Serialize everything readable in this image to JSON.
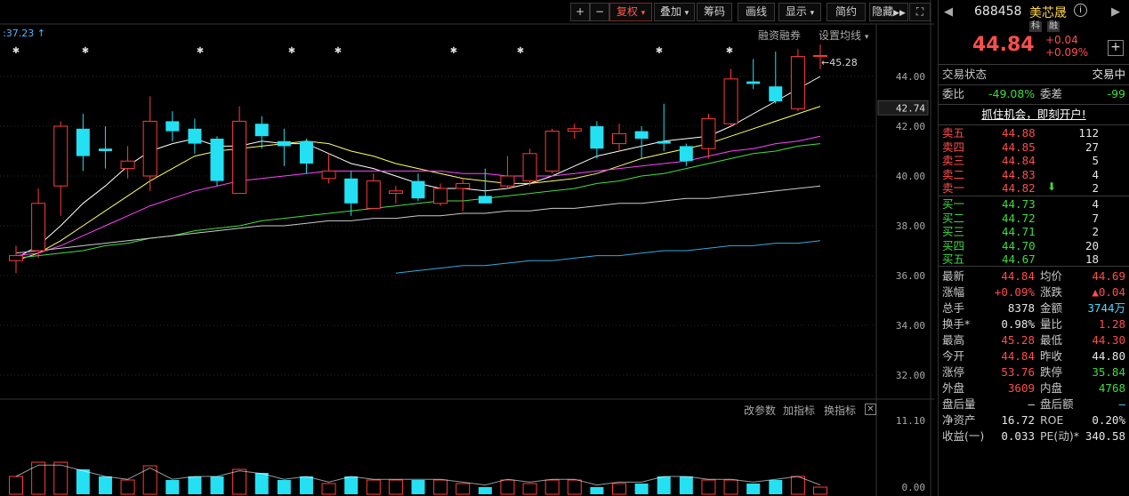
{
  "toolbar": {
    "plus": "+",
    "minus": "−",
    "fuquan": "复权",
    "overlay": "叠加",
    "chips": "筹码",
    "draw": "画线",
    "display": "显示",
    "simple": "简约",
    "hide": "隐藏"
  },
  "main": {
    "top_label": ":37.23",
    "margin_trading": "融资融券",
    "ma_settings": "设置均线",
    "max_marker": "45.28",
    "y_ticks": [
      "44.00",
      "42.00",
      "40.00",
      "38.00",
      "36.00",
      "34.00",
      "32.00"
    ],
    "current_price_tag": "42.74",
    "sub_links": [
      "改参数",
      "加指标",
      "换指标"
    ],
    "sub_axis": [
      "11.10",
      "0.00"
    ],
    "colors": {
      "up": "#ff3b3b",
      "down": "#23e0f2",
      "bg": "#000000"
    }
  },
  "chart_data": {
    "type": "candlestick",
    "ylim": [
      31,
      46
    ],
    "candles": [
      [
        36.6,
        36.8,
        37.2,
        36.1
      ],
      [
        37.0,
        38.9,
        39.5,
        36.7
      ],
      [
        39.6,
        42.0,
        42.2,
        38.4
      ],
      [
        41.9,
        40.8,
        42.5,
        40.2
      ],
      [
        41.1,
        41.0,
        42.0,
        40.3
      ],
      [
        40.3,
        40.6,
        41.2,
        39.9
      ],
      [
        40.0,
        42.2,
        43.2,
        39.4
      ],
      [
        42.2,
        41.8,
        42.6,
        41.4
      ],
      [
        41.9,
        41.3,
        42.3,
        40.9
      ],
      [
        41.5,
        39.8,
        41.6,
        39.6
      ],
      [
        39.3,
        42.2,
        42.8,
        39.3
      ],
      [
        42.1,
        41.6,
        42.4,
        41.1
      ],
      [
        41.4,
        41.2,
        41.9,
        40.4
      ],
      [
        41.4,
        40.5,
        41.5,
        40.1
      ],
      [
        39.9,
        40.2,
        40.9,
        39.7
      ],
      [
        39.9,
        38.9,
        40.2,
        38.4
      ],
      [
        38.7,
        39.8,
        40.1,
        38.7
      ],
      [
        39.3,
        39.4,
        39.6,
        38.9
      ],
      [
        39.8,
        39.1,
        40.1,
        39.0
      ],
      [
        38.9,
        39.5,
        39.7,
        38.8
      ],
      [
        39.5,
        39.7,
        39.9,
        38.6
      ],
      [
        39.2,
        38.9,
        40.3,
        38.9
      ],
      [
        39.6,
        40.0,
        40.8,
        39.5
      ],
      [
        39.8,
        40.9,
        41.1,
        39.6
      ],
      [
        40.2,
        41.8,
        41.9,
        40.1
      ],
      [
        41.8,
        41.9,
        42.1,
        41.5
      ],
      [
        42.0,
        41.1,
        42.2,
        40.7
      ],
      [
        41.3,
        41.7,
        42.1,
        41.0
      ],
      [
        41.8,
        41.5,
        42.0,
        40.7
      ],
      [
        41.4,
        41.3,
        42.9,
        41.0
      ],
      [
        41.2,
        40.6,
        41.3,
        40.4
      ],
      [
        41.1,
        42.3,
        42.5,
        40.7
      ],
      [
        42.1,
        43.9,
        44.3,
        42.0
      ],
      [
        43.8,
        43.7,
        44.7,
        43.5
      ],
      [
        43.6,
        43.0,
        45.0,
        42.9
      ],
      [
        42.7,
        44.8,
        45.1,
        42.6
      ],
      [
        44.8,
        44.84,
        45.28,
        44.3
      ]
    ],
    "ma_lines": [
      {
        "color": "#ffffff",
        "values": [
          36.7,
          37.2,
          38.0,
          38.9,
          39.6,
          40.4,
          41.0,
          41.3,
          41.5,
          41.2,
          41.2,
          41.4,
          41.3,
          41.3,
          40.9,
          40.5,
          40.3,
          40.0,
          39.7,
          39.5,
          39.5,
          39.4,
          39.5,
          39.7,
          40.0,
          40.4,
          40.8,
          41.0,
          41.2,
          41.4,
          41.5,
          41.6,
          42.0,
          42.5,
          43.0,
          43.5,
          44.0
        ]
      },
      {
        "color": "#ffff66",
        "values": [
          36.6,
          36.9,
          37.4,
          38.0,
          38.6,
          39.2,
          39.8,
          40.3,
          40.8,
          41.0,
          41.1,
          41.2,
          41.3,
          41.4,
          41.3,
          41.0,
          40.8,
          40.5,
          40.3,
          40.1,
          39.9,
          39.8,
          39.7,
          39.7,
          39.8,
          39.9,
          40.1,
          40.4,
          40.7,
          40.9,
          41.1,
          41.3,
          41.6,
          41.9,
          42.2,
          42.5,
          42.8
        ]
      },
      {
        "color": "#ff44ff",
        "values": [
          36.8,
          36.9,
          37.2,
          37.6,
          38.0,
          38.4,
          38.8,
          39.1,
          39.4,
          39.6,
          39.8,
          39.9,
          40.0,
          40.1,
          40.2,
          40.2,
          40.2,
          40.2,
          40.2,
          40.2,
          40.1,
          40.1,
          40.0,
          40.0,
          40.0,
          40.1,
          40.2,
          40.3,
          40.4,
          40.5,
          40.6,
          40.8,
          41.0,
          41.1,
          41.3,
          41.4,
          41.6
        ]
      },
      {
        "color": "#44dd44",
        "values": [
          36.7,
          36.8,
          36.9,
          37.0,
          37.2,
          37.3,
          37.5,
          37.6,
          37.8,
          37.9,
          38.0,
          38.2,
          38.3,
          38.4,
          38.5,
          38.6,
          38.7,
          38.8,
          38.9,
          39.0,
          39.0,
          39.1,
          39.2,
          39.3,
          39.4,
          39.5,
          39.7,
          39.8,
          40.0,
          40.1,
          40.3,
          40.5,
          40.7,
          40.9,
          41.0,
          41.2,
          41.3
        ]
      },
      {
        "color": "#cccccc",
        "values": [
          36.9,
          37.0,
          37.1,
          37.2,
          37.3,
          37.4,
          37.5,
          37.6,
          37.7,
          37.8,
          37.9,
          38.0,
          38.0,
          38.1,
          38.2,
          38.2,
          38.3,
          38.3,
          38.4,
          38.4,
          38.5,
          38.5,
          38.6,
          38.6,
          38.7,
          38.7,
          38.8,
          38.9,
          38.9,
          39.0,
          39.1,
          39.1,
          39.2,
          39.3,
          39.4,
          39.5,
          39.6
        ]
      },
      {
        "color": "#33aadd",
        "start": 17,
        "values": [
          36.1,
          36.2,
          36.3,
          36.4,
          36.4,
          36.5,
          36.6,
          36.6,
          36.7,
          36.8,
          36.8,
          36.9,
          37.0,
          37.0,
          37.1,
          37.2,
          37.2,
          37.3,
          37.3,
          37.4
        ]
      }
    ],
    "volumes": [
      5,
      9,
      9,
      7,
      5,
      4,
      8,
      4,
      5,
      5,
      7,
      6,
      4,
      5,
      3,
      5,
      4,
      4,
      4,
      4,
      3,
      2,
      4,
      3,
      4,
      4,
      2,
      3,
      3,
      5,
      5,
      4,
      4,
      3,
      4,
      5,
      2
    ]
  },
  "panel": {
    "code": "688458",
    "name": "美芯晟",
    "tag1": "科",
    "tag2": "融",
    "price": "44.84",
    "change": "+0.04",
    "change_pct": "+0.09%",
    "status_label": "交易状态",
    "status_value": "交易中",
    "ratio_label": "委比",
    "ratio_value": "-49.08%",
    "diff_label": "委差",
    "diff_value": "-99",
    "banner": "抓住机会，即刻开户!",
    "asks": [
      {
        "label": "卖五",
        "price": "44.88",
        "vol": "112"
      },
      {
        "label": "卖四",
        "price": "44.85",
        "vol": "27"
      },
      {
        "label": "卖三",
        "price": "44.84",
        "vol": "5"
      },
      {
        "label": "卖二",
        "price": "44.83",
        "vol": "4"
      },
      {
        "label": "卖一",
        "price": "44.82",
        "vol": "2"
      }
    ],
    "bids": [
      {
        "label": "买一",
        "price": "44.73",
        "vol": "4"
      },
      {
        "label": "买二",
        "price": "44.72",
        "vol": "7"
      },
      {
        "label": "买三",
        "price": "44.71",
        "vol": "2"
      },
      {
        "label": "买四",
        "price": "44.70",
        "vol": "20"
      },
      {
        "label": "买五",
        "price": "44.67",
        "vol": "18"
      }
    ],
    "stats": [
      {
        "l1": "最新",
        "v1": "44.84",
        "c1": "red",
        "l2": "均价",
        "v2": "44.69",
        "c2": "red"
      },
      {
        "l1": "涨幅",
        "v1": "+0.09%",
        "c1": "red",
        "l2": "涨跌",
        "v2": "▲0.04",
        "c2": "red"
      },
      {
        "l1": "总手",
        "v1": "8378",
        "c1": "white",
        "l2": "金额",
        "v2": "3744万",
        "c2": "cyan"
      },
      {
        "l1": "换手*",
        "v1": "0.98%",
        "c1": "white",
        "l2": "量比",
        "v2": "1.28",
        "c2": "red"
      },
      {
        "l1": "最高",
        "v1": "45.28",
        "c1": "red",
        "l2": "最低",
        "v2": "44.30",
        "c2": "red"
      },
      {
        "l1": "今开",
        "v1": "44.84",
        "c1": "red",
        "l2": "昨收",
        "v2": "44.80",
        "c2": "white"
      },
      {
        "l1": "涨停",
        "v1": "53.76",
        "c1": "red",
        "l2": "跌停",
        "v2": "35.84",
        "c2": "green"
      },
      {
        "l1": "外盘",
        "v1": "3609",
        "c1": "red",
        "l2": "内盘",
        "v2": "4768",
        "c2": "green"
      },
      {
        "l1": "盘后量",
        "v1": "—",
        "c1": "white",
        "l2": "盘后额",
        "v2": "—",
        "c2": "cyan"
      },
      {
        "l1": "净资产",
        "v1": "16.72",
        "c1": "white",
        "l2": "ROE",
        "v2": "0.20%",
        "c2": "white"
      },
      {
        "l1": "收益(一)",
        "v1": "0.033",
        "c1": "white",
        "l2": "PE(动)*",
        "v2": "340.58",
        "c2": "white"
      }
    ]
  }
}
